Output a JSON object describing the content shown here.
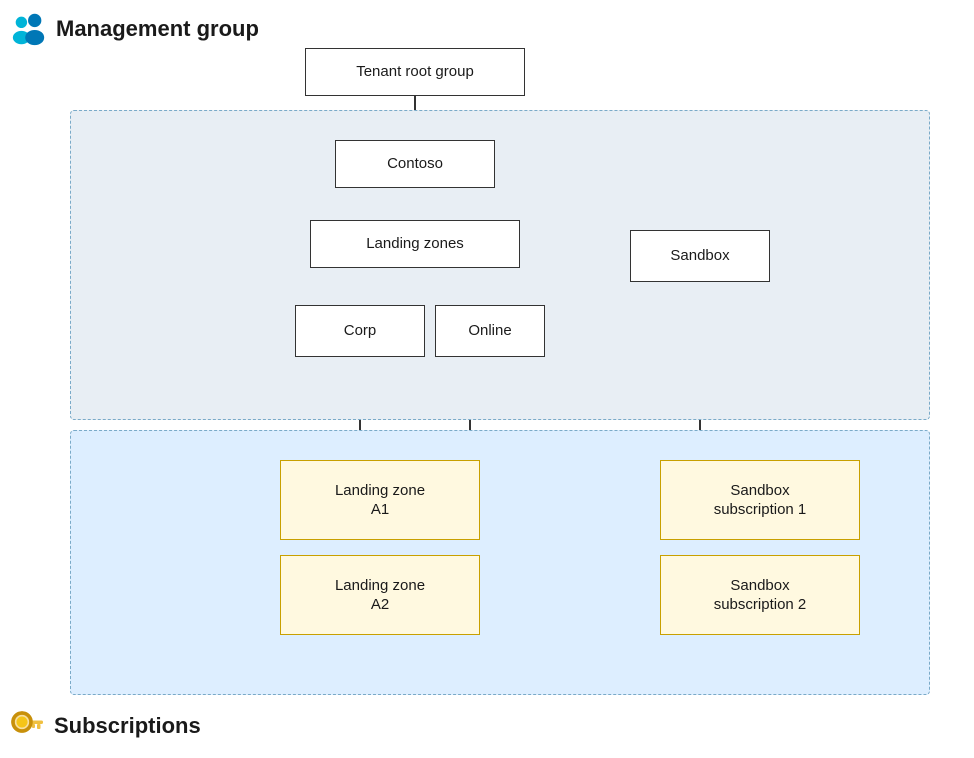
{
  "header": {
    "mgmt_label": "Management group",
    "subs_label": "Subscriptions"
  },
  "boxes": {
    "tenant_root": "Tenant root group",
    "contoso": "Contoso",
    "landing_zones": "Landing zones",
    "sandbox": "Sandbox",
    "corp": "Corp",
    "online": "Online",
    "lz_a1": "Landing zone\nA1",
    "lz_a2": "Landing zone\nA2",
    "sandbox_sub1": "Sandbox\nsubscription 1",
    "sandbox_sub2": "Sandbox\nsubscription 2"
  },
  "icons": {
    "people": "people-icon",
    "key": "key-icon"
  }
}
